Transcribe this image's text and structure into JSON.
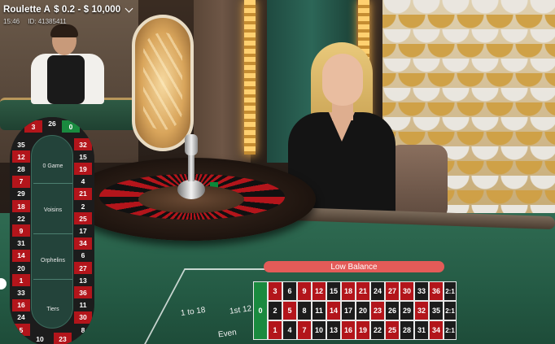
{
  "header": {
    "title": "Roulette A",
    "limits": "$ 0.2 - $ 10,000",
    "time": "15:46",
    "game_id": "ID: 41385411"
  },
  "notice": {
    "low_balance": "Low Balance"
  },
  "racetrack": {
    "top": [
      "3",
      "26",
      "0"
    ],
    "left_column": [
      "35",
      "12",
      "28",
      "7",
      "29",
      "18",
      "22",
      "9",
      "31",
      "14",
      "20",
      "1",
      "33",
      "16",
      "24",
      "5"
    ],
    "right_column": [
      "32",
      "15",
      "19",
      "4",
      "21",
      "2",
      "25",
      "17",
      "34",
      "6",
      "27",
      "13",
      "36",
      "11",
      "30",
      "8"
    ],
    "bottom": [
      "10",
      "23"
    ],
    "sections": {
      "zero_game": "0 Game",
      "voisins": "Voisins",
      "orphelins": "Orphelins",
      "tiers": "Tiers"
    }
  },
  "table_labels": {
    "one_to_18": "1 to 18",
    "first_12": "1st 12",
    "even": "Even"
  },
  "grid": {
    "zero": "0",
    "row_top": [
      "3",
      "6",
      "9",
      "12",
      "15",
      "18",
      "21",
      "24",
      "27",
      "30",
      "33",
      "36"
    ],
    "row_mid": [
      "2",
      "5",
      "8",
      "11",
      "14",
      "17",
      "20",
      "23",
      "26",
      "29",
      "32",
      "35"
    ],
    "row_bot": [
      "1",
      "4",
      "7",
      "10",
      "13",
      "16",
      "19",
      "22",
      "25",
      "28",
      "31",
      "34"
    ],
    "column_bets": [
      "2:1",
      "2:1",
      "2:1"
    ],
    "red_numbers": [
      1,
      3,
      5,
      7,
      9,
      12,
      14,
      16,
      18,
      19,
      21,
      23,
      25,
      27,
      30,
      32,
      34,
      36
    ]
  },
  "colors": {
    "red": "#b3151b",
    "black": "#1c1c1c",
    "green": "#1a8a3f",
    "notice": "#e35b58"
  }
}
